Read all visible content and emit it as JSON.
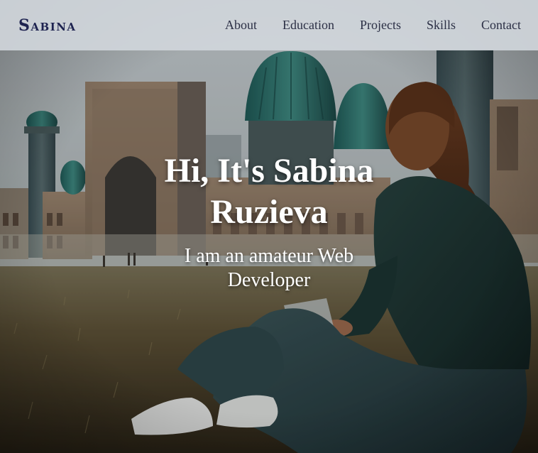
{
  "nav": {
    "logo": "Sabina",
    "links": [
      "About",
      "Education",
      "Projects",
      "Skills",
      "Contact"
    ]
  },
  "hero": {
    "title": "Hi, It's Sabina Ruzieva",
    "subtitle": "I am an amateur Web Developer",
    "background_image": "photo-of-woman-sitting-in-grass-before-registan-madrasas"
  }
}
